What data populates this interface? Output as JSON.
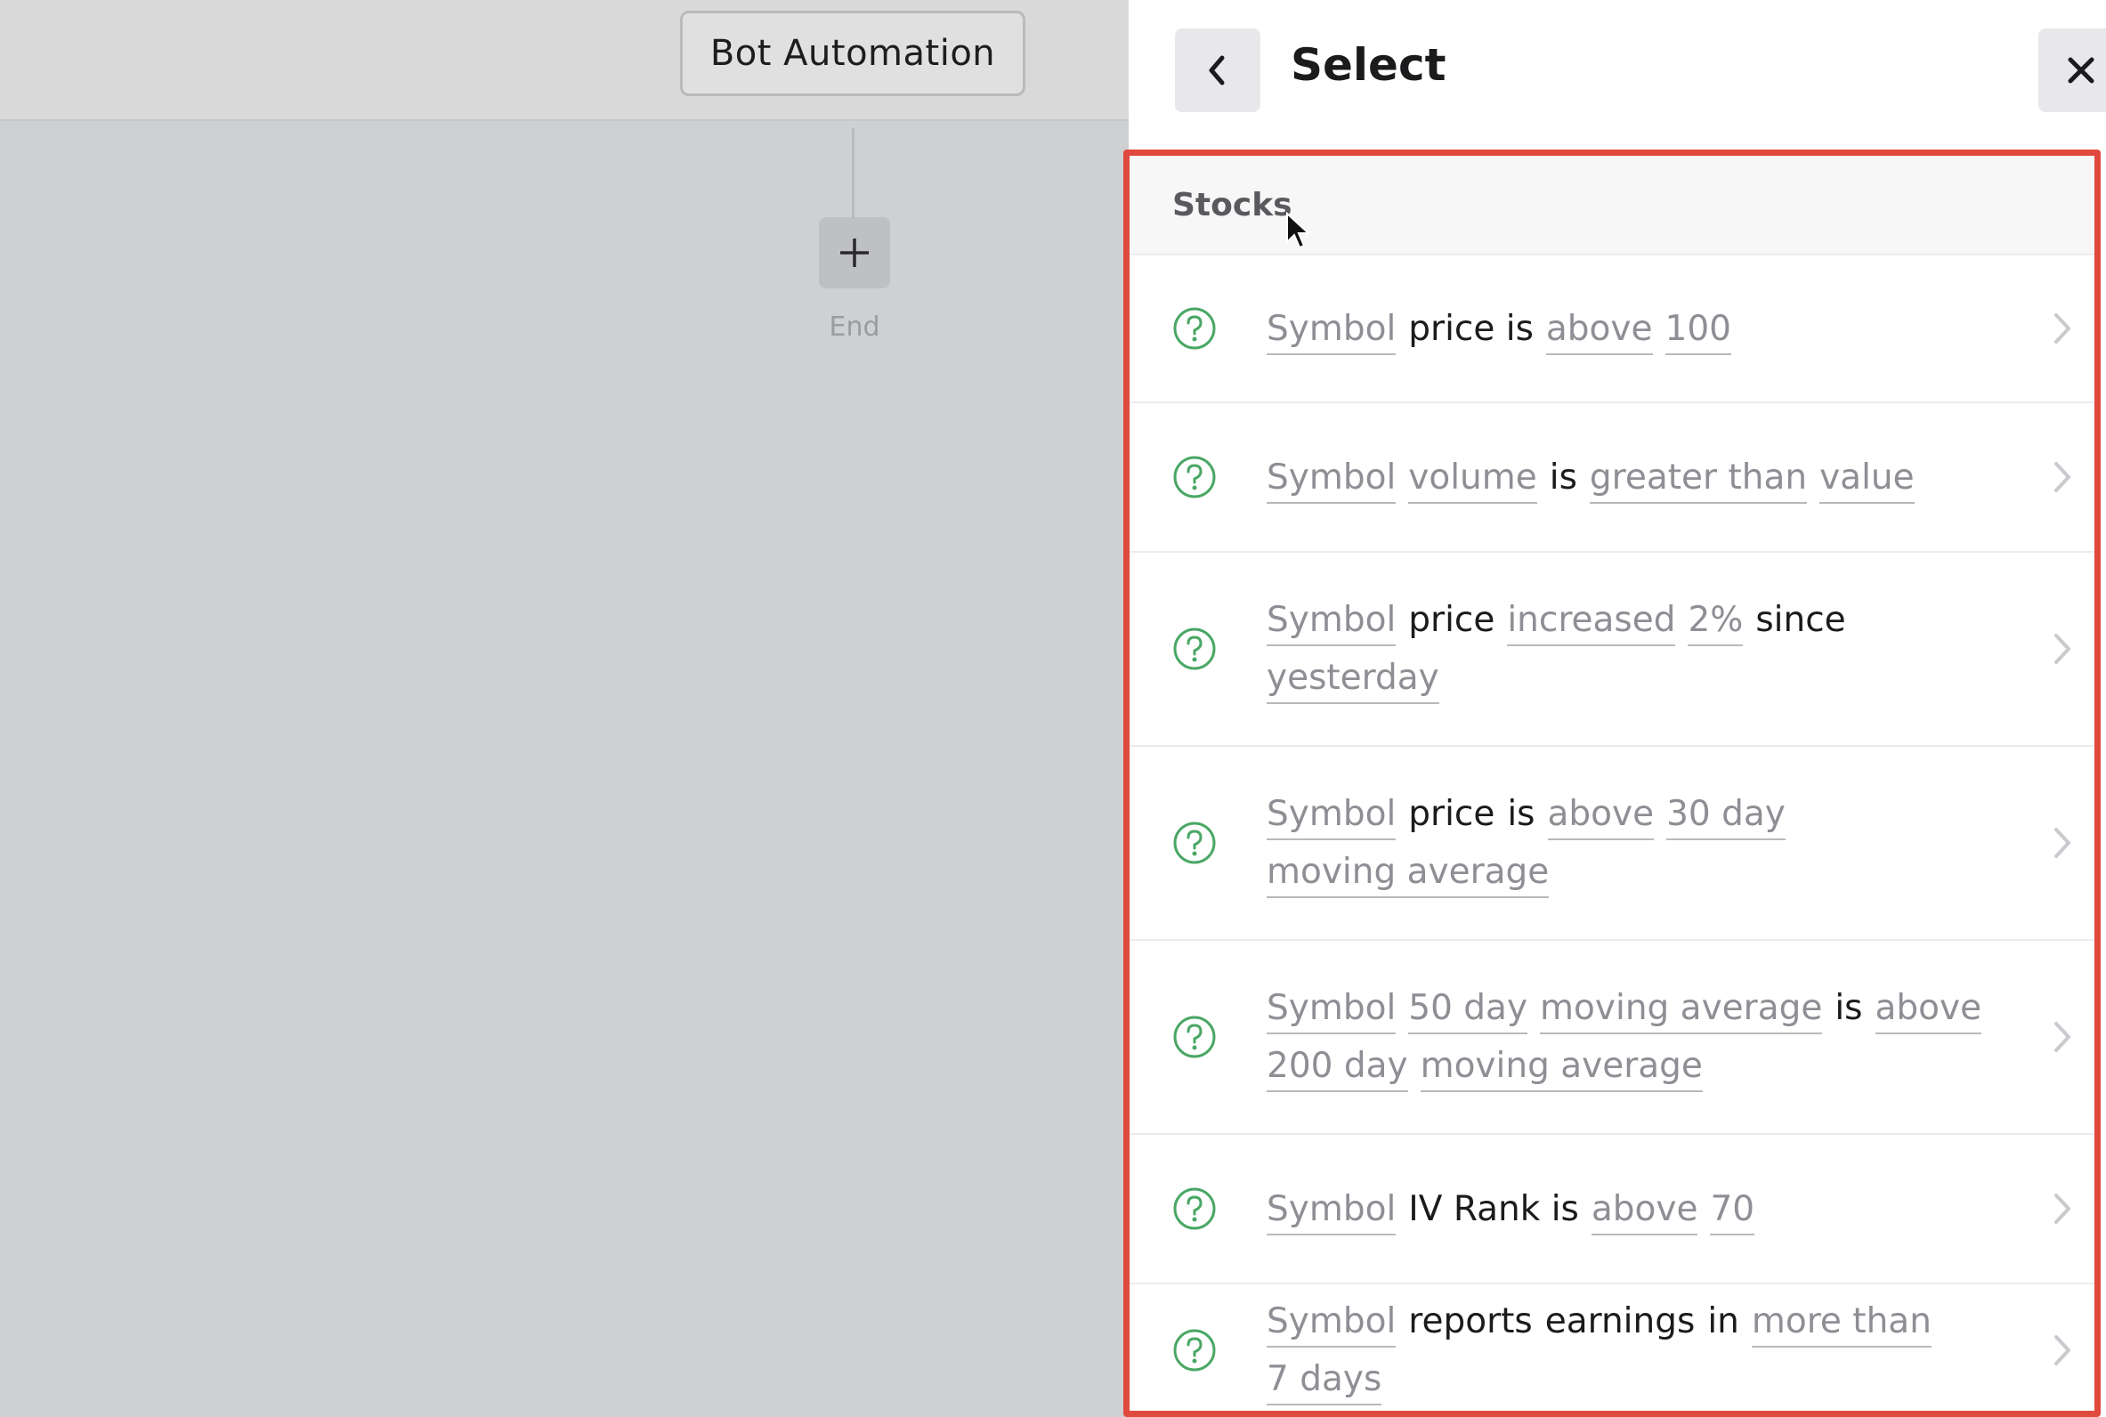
{
  "canvas": {
    "bot_button_label": "Bot Automation",
    "end_label": "End"
  },
  "panel": {
    "title": "Select",
    "section_label": "Stocks",
    "rows": [
      {
        "tokens": [
          {
            "t": "Symbol",
            "k": "v"
          },
          {
            "t": "price is",
            "k": "f"
          },
          {
            "t": "above",
            "k": "v"
          },
          {
            "t": "100",
            "k": "v"
          }
        ]
      },
      {
        "tokens": [
          {
            "t": "Symbol",
            "k": "v"
          },
          {
            "t": "volume",
            "k": "v"
          },
          {
            "t": "is",
            "k": "f"
          },
          {
            "t": "greater than",
            "k": "v"
          },
          {
            "t": "value",
            "k": "v"
          }
        ]
      },
      {
        "tokens": [
          {
            "t": "Symbol",
            "k": "v"
          },
          {
            "t": "price",
            "k": "f"
          },
          {
            "t": "increased",
            "k": "v"
          },
          {
            "t": "2%",
            "k": "v"
          },
          {
            "t": "since",
            "k": "f"
          },
          {
            "t": "yesterday",
            "k": "v"
          }
        ]
      },
      {
        "tokens": [
          {
            "t": "Symbol",
            "k": "v"
          },
          {
            "t": "price",
            "k": "f"
          },
          {
            "t": "is",
            "k": "f"
          },
          {
            "t": "above",
            "k": "v"
          },
          {
            "t": "30 day",
            "k": "v"
          },
          {
            "t": "moving average",
            "k": "v"
          }
        ]
      },
      {
        "tokens": [
          {
            "t": "Symbol",
            "k": "v"
          },
          {
            "t": "50 day",
            "k": "v"
          },
          {
            "t": "moving average",
            "k": "v"
          },
          {
            "t": "is",
            "k": "f"
          },
          {
            "t": "above",
            "k": "v"
          },
          {
            "t": "200 day",
            "k": "v"
          },
          {
            "t": "moving average",
            "k": "v"
          }
        ]
      },
      {
        "tokens": [
          {
            "t": "Symbol",
            "k": "v"
          },
          {
            "t": "IV Rank is",
            "k": "f"
          },
          {
            "t": "above",
            "k": "v"
          },
          {
            "t": "70",
            "k": "v"
          }
        ]
      },
      {
        "tokens": [
          {
            "t": "Symbol",
            "k": "v"
          },
          {
            "t": "reports",
            "k": "f"
          },
          {
            "t": "earnings",
            "k": "f"
          },
          {
            "t": "in",
            "k": "f"
          },
          {
            "t": "more than",
            "k": "v"
          },
          {
            "t": "7 days",
            "k": "v"
          }
        ]
      }
    ]
  },
  "colors": {
    "highlight_border": "#e0493d",
    "help_icon": "#4aa765",
    "canvas_bg": "#cfd0d3"
  },
  "icons": [
    "plus-icon",
    "back-chevron-icon",
    "close-icon",
    "help-icon",
    "chevron-right-icon",
    "cursor-pointer-icon"
  ]
}
